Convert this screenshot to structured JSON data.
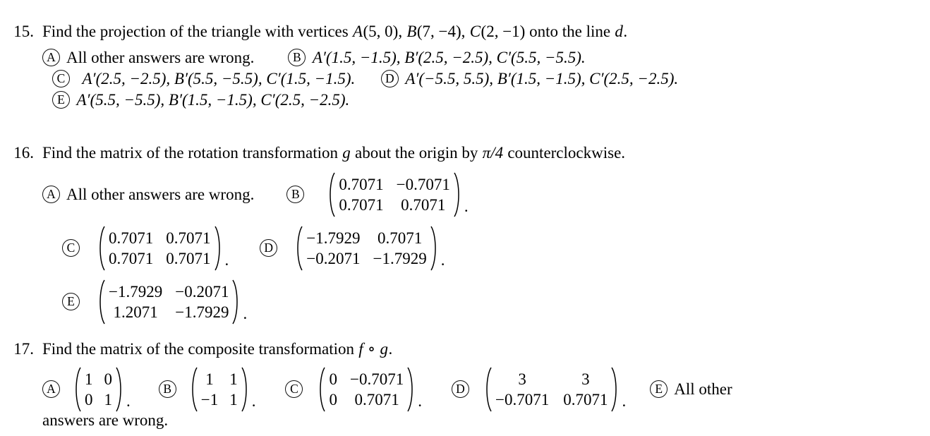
{
  "document": {
    "type": "multiple-choice-math-exam",
    "problems": [
      {
        "number": "15.",
        "stem_parts": {
          "lead": "Find the projection of the triangle with vertices ",
          "A": "A",
          "A_args": "(5, 0), ",
          "B": "B",
          "B_args": "(7, −4), ",
          "C": "C",
          "C_args": "(2, −1) ",
          "tail": "onto the line ",
          "line_var": "d",
          "end": "."
        },
        "options": [
          {
            "letter": "A",
            "text": "All other answers are wrong."
          },
          {
            "letter": "B",
            "text": "A′(1.5, −1.5), B′(2.5, −2.5), C′(5.5, −5.5)."
          },
          {
            "letter": "C",
            "text": "A′(2.5, −2.5), B′(5.5, −5.5), C′(1.5, −1.5)."
          },
          {
            "letter": "D",
            "text": "A′(−5.5, 5.5), B′(1.5, −1.5), C′(2.5, −2.5)."
          },
          {
            "letter": "E",
            "text": "A′(5.5, −5.5), B′(1.5, −1.5), C′(2.5, −2.5)."
          }
        ]
      },
      {
        "number": "16.",
        "stem_parts": {
          "lead": "Find the matrix of the rotation transformation ",
          "g": "g",
          "mid": " about the origin by ",
          "angle": "π/4",
          "tail": " counterclockwise."
        },
        "options": [
          {
            "letter": "A",
            "kind": "text",
            "text": "All other answers are wrong."
          },
          {
            "letter": "B",
            "kind": "matrix",
            "cells": [
              "0.7071",
              "−0.7071",
              "0.7071",
              "0.7071"
            ],
            "period": "."
          },
          {
            "letter": "C",
            "kind": "matrix",
            "cells": [
              "0.7071",
              "0.7071",
              "0.7071",
              "0.7071"
            ],
            "period": "."
          },
          {
            "letter": "D",
            "kind": "matrix",
            "cells": [
              "−1.7929",
              "0.7071",
              "−0.2071",
              "−1.7929"
            ],
            "period": "."
          },
          {
            "letter": "E",
            "kind": "matrix",
            "cells": [
              "−1.7929",
              "−0.2071",
              "1.2071",
              "−1.7929"
            ],
            "period": "."
          }
        ]
      },
      {
        "number": "17.",
        "stem_parts": {
          "lead": "Find the matrix of the composite transformation ",
          "f": "f",
          "circ": " ∘ ",
          "g": "g",
          "end": "."
        },
        "options": [
          {
            "letter": "A",
            "kind": "matrix",
            "cells": [
              "1",
              "0",
              "0",
              "1"
            ],
            "period": "."
          },
          {
            "letter": "B",
            "kind": "matrix",
            "cells": [
              "1",
              "1",
              "−1",
              "1"
            ],
            "period": "."
          },
          {
            "letter": "C",
            "kind": "matrix",
            "cells": [
              "0",
              "−0.7071",
              "0",
              "0.7071"
            ],
            "period": "."
          },
          {
            "letter": "D",
            "kind": "matrix",
            "cells": [
              "3",
              "3",
              "−0.7071",
              "0.7071"
            ],
            "period": "."
          },
          {
            "letter": "E",
            "kind": "text",
            "text": "All other"
          }
        ],
        "wrap_tail": "answers are wrong."
      }
    ]
  }
}
